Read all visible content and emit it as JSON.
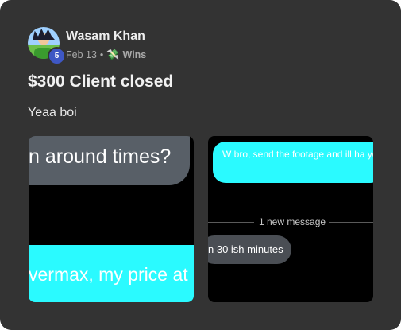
{
  "post": {
    "author": {
      "name": "Wasam Khan",
      "level": "5"
    },
    "meta": {
      "date": "Feb 13",
      "separator": "•",
      "category_icon": "money-wings-icon",
      "category": "Wins"
    },
    "title": "$300 Client closed",
    "body": "Yeaa boi"
  },
  "images": {
    "left": {
      "top_bubble_text": "n around times?",
      "bottom_bubble_text": "vermax, my price at"
    },
    "right": {
      "top_bubble_text": "W bro, send the footage and ill ha you",
      "divider_text": "1 new message",
      "bottom_bubble_text": "n 30 ish minutes"
    }
  }
}
